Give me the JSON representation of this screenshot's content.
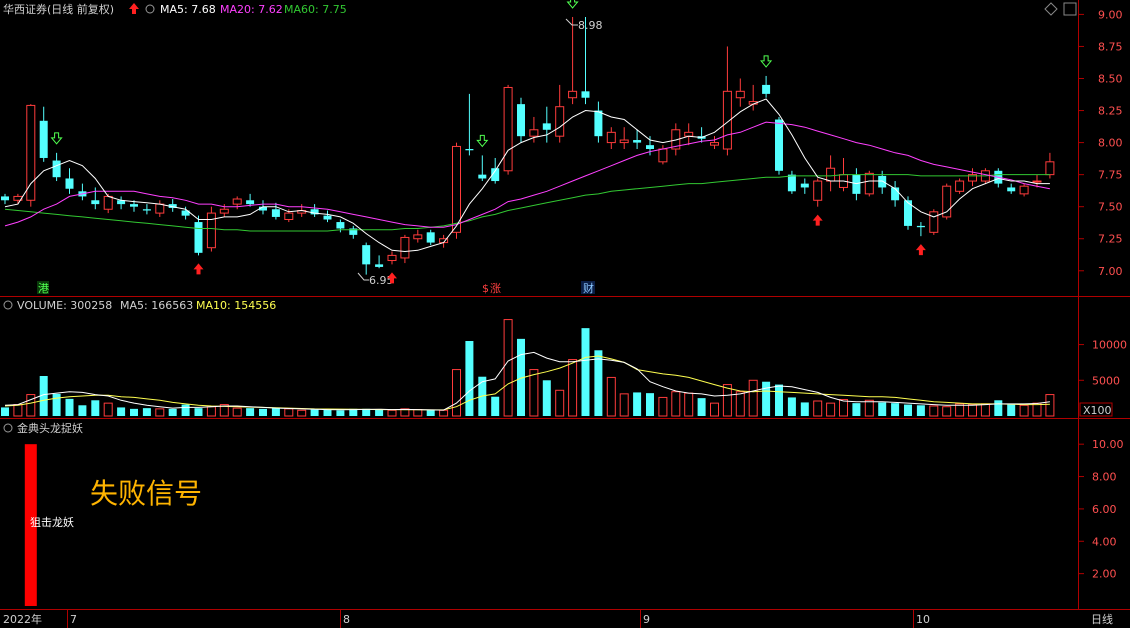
{
  "header": {
    "stock": "华西证券(日线 前复权)",
    "ma5_label": "MA5: 7.68",
    "ma20_label": "MA20: 7.62",
    "ma60_label": "MA60: 7.75"
  },
  "volume_header": {
    "title": "VOLUME: 300258",
    "ma5_label": "MA5: 166563",
    "ma10_label": "MA10: 154556",
    "unit": "X100"
  },
  "indicator_header": {
    "title": "金典头龙捉妖",
    "bar_label": "狙击龙妖",
    "signal_text": "失败信号"
  },
  "markers": {
    "hk": "港",
    "dollar": "$",
    "rise": "涨",
    "finance": "财"
  },
  "annotations": {
    "high": "8.98",
    "low": "6.95"
  },
  "footer": {
    "year": "2022年",
    "months": [
      "7",
      "8",
      "9",
      "10"
    ],
    "period": "日线"
  },
  "colors": {
    "up": "#ff3c3c",
    "down": "#54ffff",
    "ma5": "#ffffff",
    "ma20": "#ff40ff",
    "ma60": "#32c832",
    "vol_ma10": "#ffff50",
    "signal": "#ffb400",
    "axis": "#b00000"
  },
  "chart_data": [
    {
      "type": "candlestick",
      "title": "华西证券(日线 前复权)",
      "y_ticks": [
        "9.00",
        "8.75",
        "8.50",
        "8.25",
        "8.00",
        "7.75",
        "7.50",
        "7.25",
        "7.00"
      ],
      "ylim": [
        6.85,
        9.05
      ],
      "series": {
        "ohlc": [
          [
            7.58,
            7.6,
            7.52,
            7.55
          ],
          [
            7.55,
            7.6,
            7.52,
            7.58
          ],
          [
            7.55,
            8.3,
            7.5,
            8.29
          ],
          [
            8.17,
            8.28,
            7.85,
            7.88
          ],
          [
            7.86,
            7.92,
            7.7,
            7.73
          ],
          [
            7.72,
            7.8,
            7.6,
            7.64
          ],
          [
            7.62,
            7.68,
            7.55,
            7.58
          ],
          [
            7.55,
            7.65,
            7.48,
            7.52
          ],
          [
            7.48,
            7.6,
            7.45,
            7.58
          ],
          [
            7.55,
            7.58,
            7.48,
            7.52
          ],
          [
            7.52,
            7.55,
            7.46,
            7.5
          ],
          [
            7.48,
            7.52,
            7.44,
            7.47
          ],
          [
            7.45,
            7.55,
            7.42,
            7.52
          ],
          [
            7.52,
            7.56,
            7.46,
            7.49
          ],
          [
            7.47,
            7.5,
            7.4,
            7.43
          ],
          [
            7.38,
            7.43,
            7.12,
            7.14
          ],
          [
            7.18,
            7.5,
            7.15,
            7.45
          ],
          [
            7.45,
            7.52,
            7.42,
            7.48
          ],
          [
            7.52,
            7.58,
            7.48,
            7.56
          ],
          [
            7.55,
            7.6,
            7.5,
            7.52
          ],
          [
            7.5,
            7.55,
            7.44,
            7.47
          ],
          [
            7.48,
            7.53,
            7.4,
            7.42
          ],
          [
            7.4,
            7.48,
            7.38,
            7.45
          ],
          [
            7.45,
            7.52,
            7.42,
            7.47
          ],
          [
            7.48,
            7.52,
            7.42,
            7.44
          ],
          [
            7.43,
            7.47,
            7.38,
            7.4
          ],
          [
            7.38,
            7.4,
            7.3,
            7.33
          ],
          [
            7.33,
            7.35,
            7.25,
            7.28
          ],
          [
            7.2,
            7.22,
            6.97,
            7.05
          ],
          [
            7.05,
            7.12,
            7.02,
            7.03
          ],
          [
            7.08,
            7.15,
            7.05,
            7.12
          ],
          [
            7.1,
            7.28,
            7.06,
            7.26
          ],
          [
            7.25,
            7.32,
            7.22,
            7.28
          ],
          [
            7.3,
            7.32,
            7.2,
            7.22
          ],
          [
            7.22,
            7.28,
            7.18,
            7.25
          ],
          [
            7.3,
            8.0,
            7.25,
            7.97
          ],
          [
            7.95,
            8.38,
            7.9,
            7.94
          ],
          [
            7.75,
            7.9,
            7.7,
            7.72
          ],
          [
            7.8,
            7.88,
            7.68,
            7.7
          ],
          [
            7.78,
            8.45,
            7.75,
            8.43
          ],
          [
            8.3,
            8.35,
            8.0,
            8.05
          ],
          [
            8.05,
            8.2,
            8.0,
            8.1
          ],
          [
            8.15,
            8.28,
            8.0,
            8.1
          ],
          [
            8.05,
            8.45,
            8.0,
            8.28
          ],
          [
            8.35,
            8.98,
            8.3,
            8.4
          ],
          [
            8.4,
            8.98,
            8.3,
            8.35
          ],
          [
            8.25,
            8.32,
            8.0,
            8.05
          ],
          [
            8.0,
            8.12,
            7.95,
            8.08
          ],
          [
            8.0,
            8.12,
            7.95,
            8.02
          ],
          [
            8.02,
            8.1,
            7.95,
            8.0
          ],
          [
            7.98,
            8.05,
            7.9,
            7.95
          ],
          [
            7.85,
            7.98,
            7.83,
            7.95
          ],
          [
            7.95,
            8.15,
            7.9,
            8.1
          ],
          [
            8.05,
            8.15,
            7.98,
            8.08
          ],
          [
            8.05,
            8.12,
            8.0,
            8.03
          ],
          [
            7.98,
            8.05,
            7.95,
            8.0
          ],
          [
            7.95,
            8.75,
            7.9,
            8.4
          ],
          [
            8.35,
            8.5,
            8.28,
            8.4
          ],
          [
            8.3,
            8.45,
            8.25,
            8.32
          ],
          [
            8.45,
            8.52,
            8.35,
            8.38
          ],
          [
            8.18,
            8.2,
            7.75,
            7.78
          ],
          [
            7.75,
            7.78,
            7.6,
            7.62
          ],
          [
            7.68,
            7.72,
            7.6,
            7.65
          ],
          [
            7.55,
            7.72,
            7.5,
            7.7
          ],
          [
            7.7,
            7.9,
            7.62,
            7.8
          ],
          [
            7.65,
            7.88,
            7.62,
            7.75
          ],
          [
            7.75,
            7.8,
            7.55,
            7.6
          ],
          [
            7.6,
            7.78,
            7.58,
            7.76
          ],
          [
            7.74,
            7.78,
            7.6,
            7.65
          ],
          [
            7.65,
            7.7,
            7.5,
            7.55
          ],
          [
            7.55,
            7.58,
            7.32,
            7.35
          ],
          [
            7.35,
            7.38,
            7.27,
            7.34
          ],
          [
            7.3,
            7.48,
            7.28,
            7.46
          ],
          [
            7.42,
            7.68,
            7.4,
            7.66
          ],
          [
            7.62,
            7.72,
            7.6,
            7.7
          ],
          [
            7.7,
            7.8,
            7.66,
            7.75
          ],
          [
            7.7,
            7.8,
            7.68,
            7.78
          ],
          [
            7.78,
            7.8,
            7.65,
            7.68
          ],
          [
            7.65,
            7.68,
            7.6,
            7.62
          ],
          [
            7.6,
            7.68,
            7.58,
            7.66
          ],
          [
            7.7,
            7.75,
            7.65,
            7.7
          ],
          [
            7.75,
            7.92,
            7.72,
            7.85
          ]
        ],
        "ma5": [
          7.5,
          7.52,
          7.68,
          7.78,
          7.82,
          7.86,
          7.82,
          7.72,
          7.58,
          7.55,
          7.54,
          7.53,
          7.52,
          7.5,
          7.48,
          7.4,
          7.4,
          7.42,
          7.42,
          7.44,
          7.5,
          7.5,
          7.46,
          7.47,
          7.45,
          7.44,
          7.42,
          7.37,
          7.29,
          7.22,
          7.16,
          7.15,
          7.16,
          7.19,
          7.22,
          7.35,
          7.52,
          7.64,
          7.78,
          7.94,
          8.0,
          8.04,
          8.06,
          8.12,
          8.2,
          8.25,
          8.24,
          8.2,
          8.18,
          8.1,
          8.02,
          8.0,
          8.02,
          8.05,
          8.04,
          8.08,
          8.16,
          8.24,
          8.3,
          8.34,
          8.22,
          8.06,
          7.88,
          7.73,
          7.7,
          7.7,
          7.68,
          7.7,
          7.7,
          7.64,
          7.53,
          7.46,
          7.42,
          7.46,
          7.56,
          7.64,
          7.68,
          7.72,
          7.7,
          7.7,
          7.68,
          7.68
        ],
        "ma20": [
          7.35,
          7.38,
          7.42,
          7.48,
          7.52,
          7.58,
          7.6,
          7.62,
          7.62,
          7.62,
          7.62,
          7.6,
          7.58,
          7.57,
          7.55,
          7.52,
          7.52,
          7.5,
          7.5,
          7.51,
          7.52,
          7.52,
          7.5,
          7.5,
          7.49,
          7.48,
          7.46,
          7.44,
          7.42,
          7.4,
          7.38,
          7.36,
          7.35,
          7.34,
          7.34,
          7.36,
          7.4,
          7.44,
          7.48,
          7.54,
          7.56,
          7.59,
          7.62,
          7.66,
          7.7,
          7.74,
          7.78,
          7.82,
          7.86,
          7.9,
          7.93,
          7.95,
          7.97,
          7.99,
          8.01,
          8.02,
          8.06,
          8.08,
          8.12,
          8.16,
          8.15,
          8.14,
          8.12,
          8.09,
          8.06,
          8.03,
          8.0,
          7.98,
          7.95,
          7.92,
          7.9,
          7.86,
          7.83,
          7.81,
          7.79,
          7.77,
          7.75,
          7.73,
          7.71,
          7.68,
          7.66,
          7.64
        ],
        "ma60": [
          7.48,
          7.47,
          7.46,
          7.45,
          7.44,
          7.43,
          7.42,
          7.41,
          7.4,
          7.39,
          7.38,
          7.37,
          7.36,
          7.35,
          7.34,
          7.33,
          7.33,
          7.32,
          7.32,
          7.31,
          7.31,
          7.31,
          7.31,
          7.31,
          7.31,
          7.31,
          7.32,
          7.32,
          7.32,
          7.32,
          7.32,
          7.33,
          7.33,
          7.34,
          7.35,
          7.37,
          7.39,
          7.42,
          7.44,
          7.47,
          7.49,
          7.51,
          7.53,
          7.55,
          7.57,
          7.59,
          7.6,
          7.62,
          7.63,
          7.64,
          7.65,
          7.66,
          7.67,
          7.68,
          7.68,
          7.69,
          7.7,
          7.71,
          7.72,
          7.73,
          7.73,
          7.74,
          7.74,
          7.74,
          7.74,
          7.75,
          7.75,
          7.75,
          7.75,
          7.75,
          7.75,
          7.74,
          7.74,
          7.74,
          7.74,
          7.74,
          7.74,
          7.75,
          7.75,
          7.75,
          7.75,
          7.75
        ]
      }
    },
    {
      "type": "bar",
      "title": "VOLUME",
      "y_ticks": [
        "10000",
        "5000"
      ],
      "ylim": [
        0,
        14000
      ],
      "values": [
        1200,
        1600,
        3000,
        5600,
        3100,
        2400,
        1500,
        2200,
        1800,
        1200,
        1000,
        1100,
        1000,
        1000,
        1600,
        1100,
        1300,
        1600,
        1100,
        1100,
        1000,
        1100,
        1000,
        800,
        900,
        900,
        800,
        1000,
        1000,
        900,
        800,
        1000,
        900,
        800,
        800,
        6500,
        10500,
        5500,
        2700,
        13500,
        10800,
        6500,
        5000,
        3600,
        7900,
        12300,
        9200,
        5400,
        3100,
        3300,
        3200,
        2600,
        3400,
        3200,
        2500,
        1800,
        4400,
        3400,
        5000,
        4800,
        4400,
        2600,
        1900,
        2100,
        1800,
        2300,
        1800,
        2200,
        1900,
        1800,
        1600,
        1500,
        1400,
        1300,
        1700,
        1600,
        1700,
        2200,
        1600,
        1500,
        1800,
        3000
      ],
      "ma5": [
        1500,
        1600,
        2300,
        3000,
        3200,
        3400,
        3300,
        3000,
        2800,
        2200,
        1800,
        1500,
        1300,
        1100,
        1200,
        1200,
        1300,
        1400,
        1400,
        1300,
        1200,
        1100,
        1050,
        1000,
        950,
        900,
        880,
        900,
        920,
        950,
        900,
        920,
        900,
        850,
        820,
        1800,
        3500,
        4800,
        5200,
        7700,
        8600,
        8900,
        8100,
        7600,
        7600,
        7800,
        8000,
        7800,
        7500,
        6600,
        4800,
        4100,
        3500,
        3200,
        3100,
        2800,
        2900,
        3100,
        3500,
        3900,
        4200,
        4100,
        3700,
        3300,
        2600,
        2100,
        2000,
        2000,
        2000,
        1900,
        1800,
        1700,
        1600,
        1500,
        1500,
        1500,
        1600,
        1700,
        1700,
        1700,
        1750,
        2000
      ],
      "ma10": [
        1400,
        1500,
        1800,
        2200,
        2500,
        2700,
        2800,
        2900,
        2900,
        2700,
        2600,
        2400,
        2200,
        1900,
        1700,
        1500,
        1400,
        1350,
        1300,
        1250,
        1200,
        1150,
        1100,
        1050,
        1000,
        980,
        960,
        940,
        920,
        900,
        890,
        880,
        870,
        860,
        850,
        1300,
        2200,
        2800,
        3100,
        4500,
        5300,
        5800,
        6200,
        6700,
        7400,
        8200,
        8400,
        8000,
        7500,
        6500,
        6200,
        5900,
        5700,
        5400,
        4900,
        4400,
        3900,
        3500,
        3400,
        3500,
        3400,
        3300,
        3200,
        3100,
        3000,
        2900,
        2800,
        2700,
        2700,
        2600,
        2400,
        2200,
        2000,
        1900,
        1800,
        1700,
        1700,
        1700,
        1650,
        1600,
        1600,
        1650
      ]
    },
    {
      "type": "bar",
      "title": "金典头龙捉妖",
      "y_ticks": [
        "10.00",
        "8.00",
        "6.00",
        "4.00",
        "2.00"
      ],
      "ylim": [
        0,
        11
      ],
      "values": [
        0,
        0,
        10
      ],
      "note": "狙击龙妖"
    }
  ]
}
